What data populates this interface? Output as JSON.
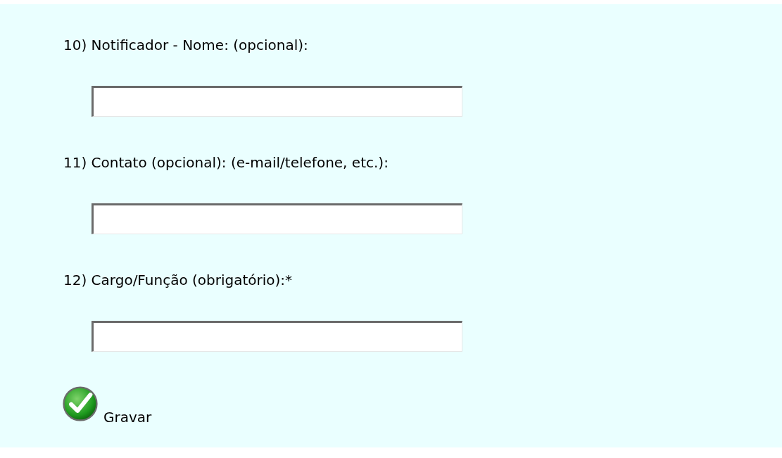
{
  "questions": [
    {
      "label": "10) Notificador - Nome: (opcional):"
    },
    {
      "label": "11) Contato (opcional): (e-mail/telefone, etc.):"
    },
    {
      "label": "12) Cargo/Função (obrigatório):*"
    }
  ],
  "save_button": {
    "label": "Gravar"
  }
}
